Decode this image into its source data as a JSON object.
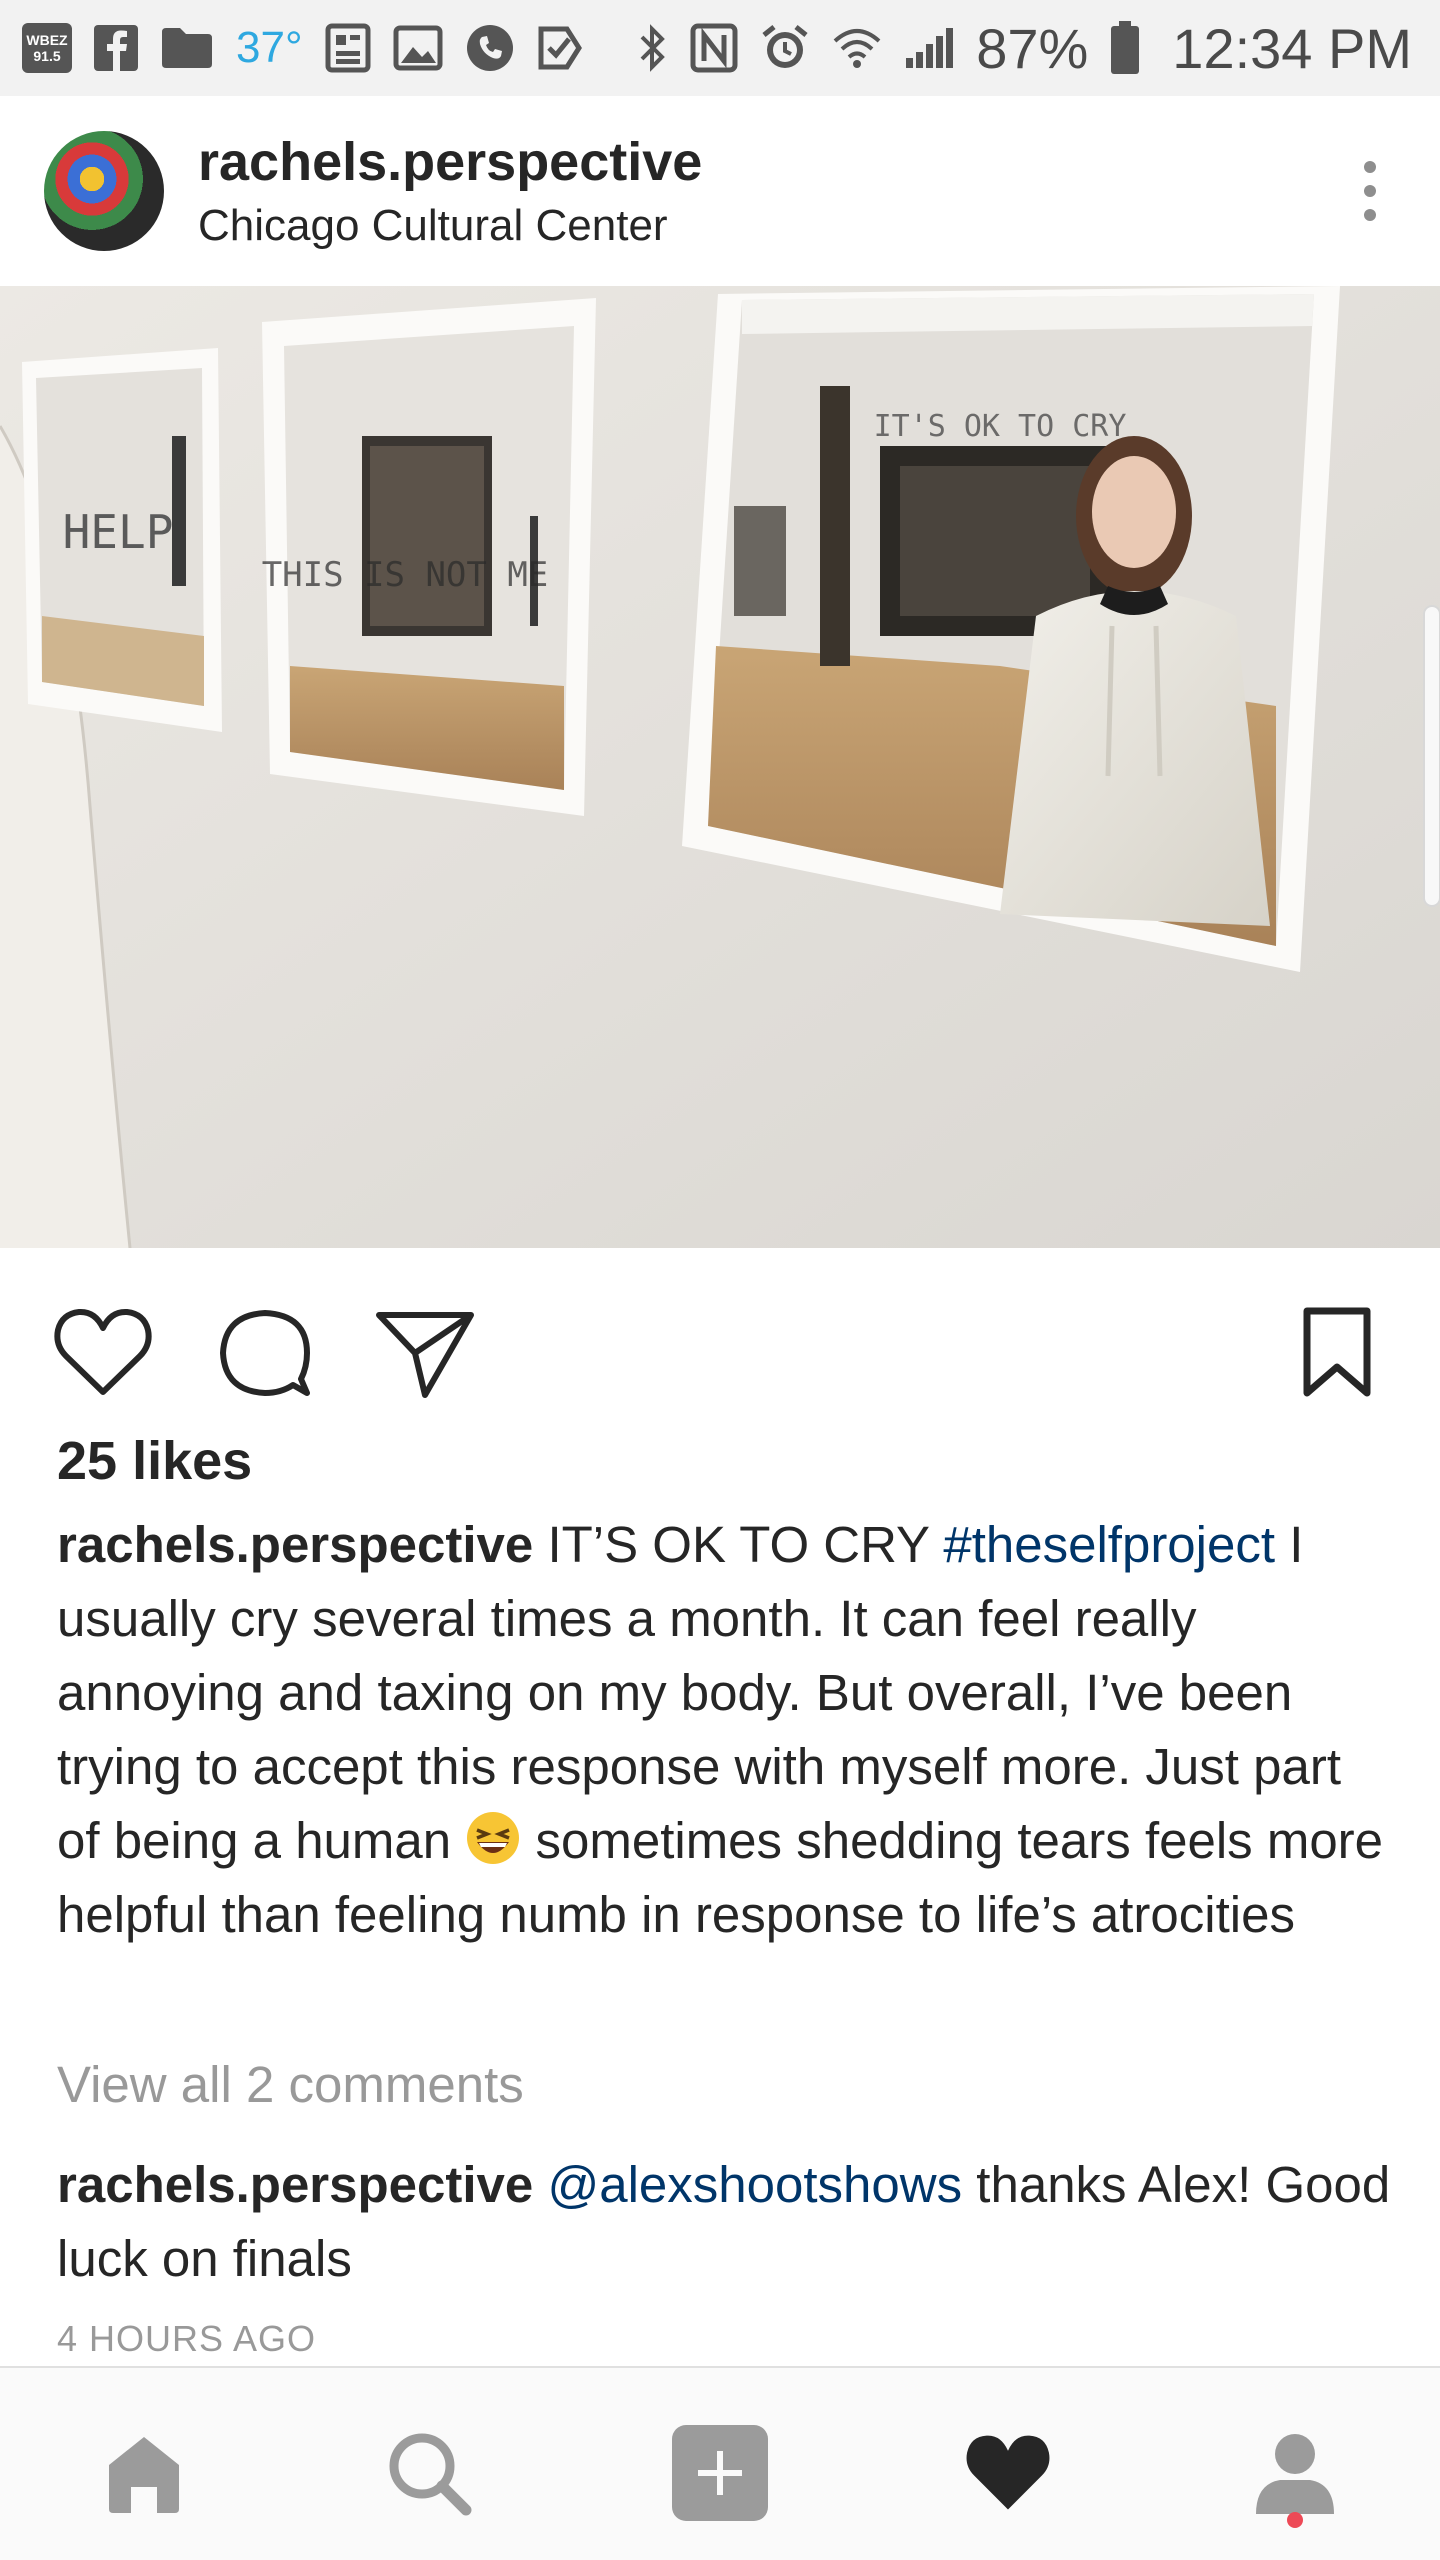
{
  "status_bar": {
    "radio_badge_top": "WBEZ",
    "radio_badge_bottom": "91.5",
    "temperature": "37°",
    "battery_percent": "87%",
    "time": "12:34 PM",
    "icons": [
      "facebook-icon",
      "folder-icon",
      "news-icon",
      "gallery-icon",
      "phone-icon",
      "tasks-icon",
      "bluetooth-icon",
      "nfc-icon",
      "alarm-icon",
      "wifi-icon",
      "signal-icon",
      "battery-icon"
    ]
  },
  "post": {
    "username": "rachels.perspective",
    "location": "Chicago Cultural Center",
    "photo_text": {
      "frame1": "HELP",
      "frame2": "THIS IS NOT ME",
      "frame3": "IT'S OK TO CRY"
    },
    "likes": "25 likes",
    "caption": {
      "user": "rachels.perspective",
      "text_1": " IT’S OK TO CRY ",
      "hashtag": "#theselfproject",
      "text_2": " I usually cry several times a month. It can feel really annoying and taxing on my body. But overall, I’ve been trying to accept this response with myself more. Just part of being a human ",
      "emoji": "grinning-squinting-face",
      "text_3": " sometimes shedding tears feels more helpful than feeling numb in response to life’s atrocities"
    },
    "view_comments": "View all 2 comments",
    "comment": {
      "user": "rachels.perspective",
      "mention": "@alexshootshows",
      "text": " thanks Alex! Good luck on finals"
    },
    "timestamp": "4 HOURS AGO"
  },
  "actions": [
    "heart-icon",
    "comment-icon",
    "share-icon",
    "bookmark-icon"
  ],
  "nav": [
    "home-icon",
    "search-icon",
    "add-icon",
    "activity-heart-icon",
    "profile-icon"
  ],
  "colors": {
    "link": "#003569",
    "muted": "#999999",
    "text": "#262626",
    "notification": "#ed4956"
  }
}
